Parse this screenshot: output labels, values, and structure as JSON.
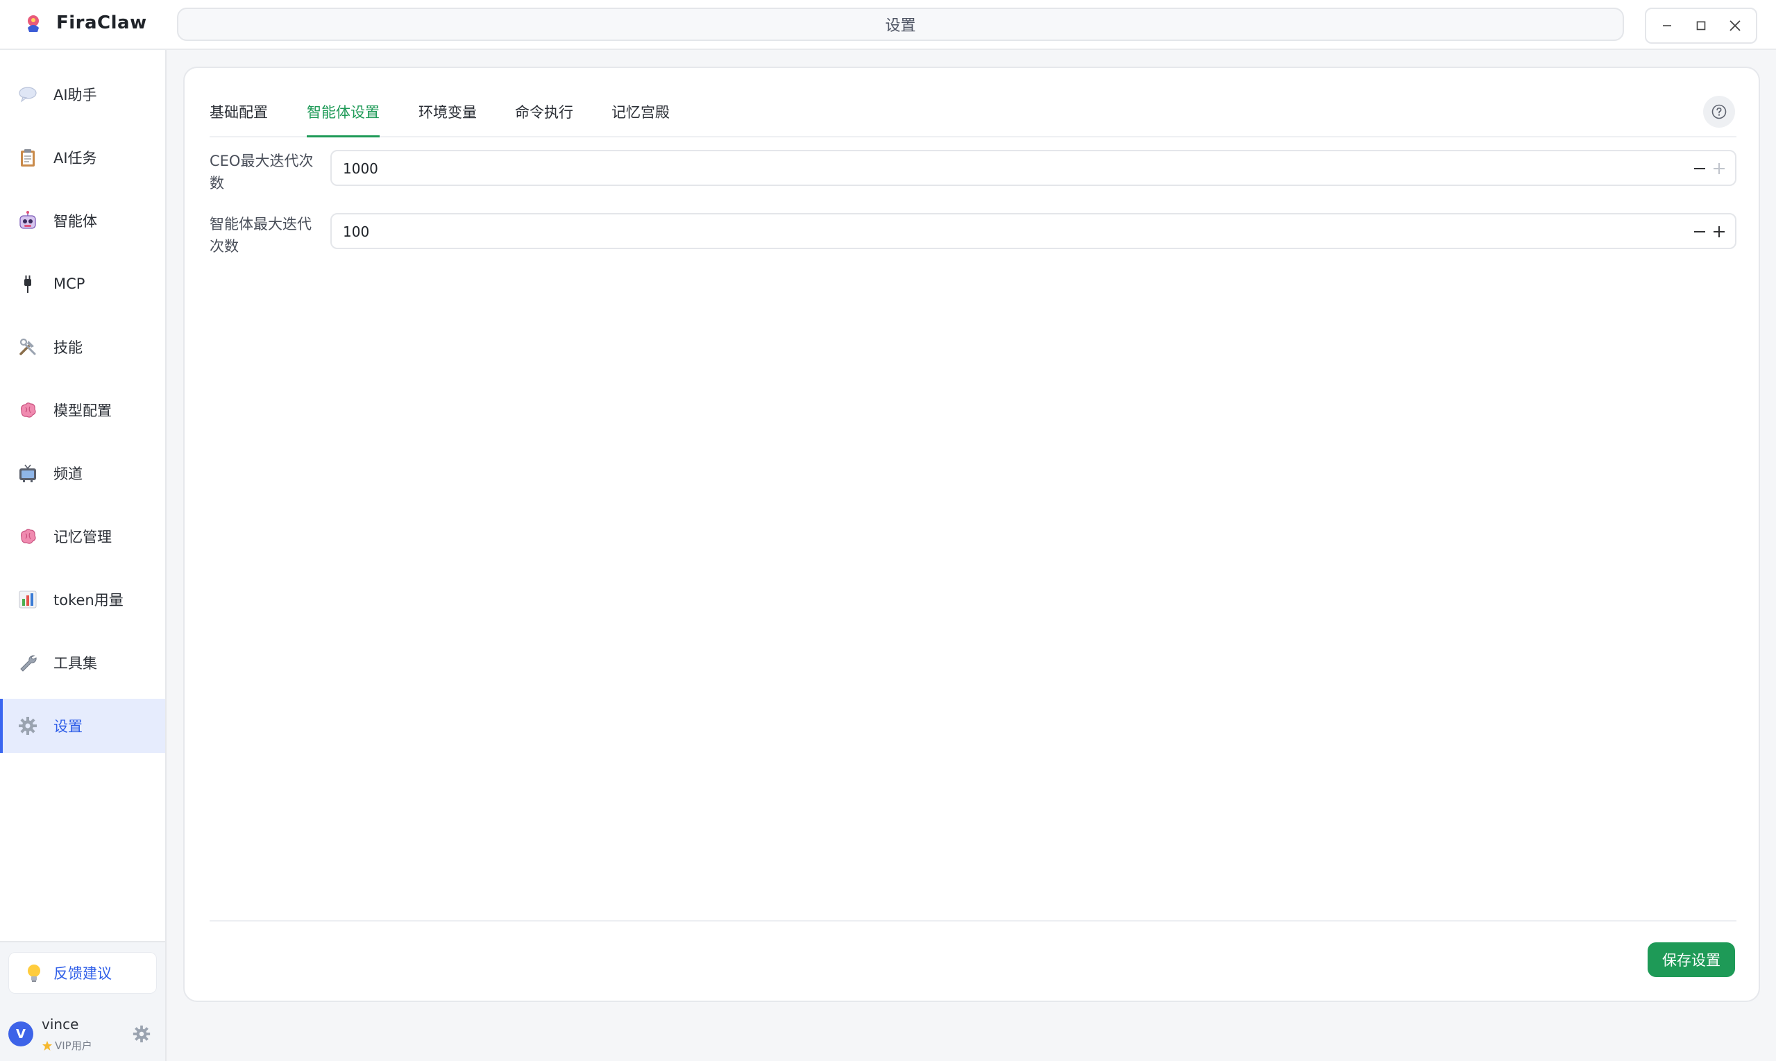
{
  "app": {
    "name": "FiraClaw",
    "window_title": "设置"
  },
  "sidebar": {
    "items": [
      {
        "label": "AI助手",
        "icon": "speech-bubble-icon"
      },
      {
        "label": "AI任务",
        "icon": "clipboard-icon"
      },
      {
        "label": "智能体",
        "icon": "robot-icon"
      },
      {
        "label": "MCP",
        "icon": "plug-icon"
      },
      {
        "label": "技能",
        "icon": "tools-icon"
      },
      {
        "label": "模型配置",
        "icon": "brain-icon"
      },
      {
        "label": "频道",
        "icon": "tv-icon"
      },
      {
        "label": "记忆管理",
        "icon": "brain-icon"
      },
      {
        "label": "token用量",
        "icon": "bar-chart-icon"
      },
      {
        "label": "工具集",
        "icon": "wrench-icon"
      },
      {
        "label": "设置",
        "icon": "gear-icon",
        "active": true
      }
    ],
    "feedback_label": "反馈建议",
    "user": {
      "initial": "V",
      "name": "vince",
      "badge": "VIP用户"
    }
  },
  "settings": {
    "tabs": [
      "基础配置",
      "智能体设置",
      "环境变量",
      "命令执行",
      "记忆宫殿"
    ],
    "active_tab": "智能体设置",
    "fields": [
      {
        "label": "CEO最大迭代次数",
        "value": "1000"
      },
      {
        "label": "智能体最大迭代次数",
        "value": "100"
      }
    ],
    "save_label": "保存设置"
  },
  "colors": {
    "accent_green": "#1e9a57",
    "accent_blue": "#3a66f0",
    "active_nav_bg": "#e6ecfd"
  }
}
